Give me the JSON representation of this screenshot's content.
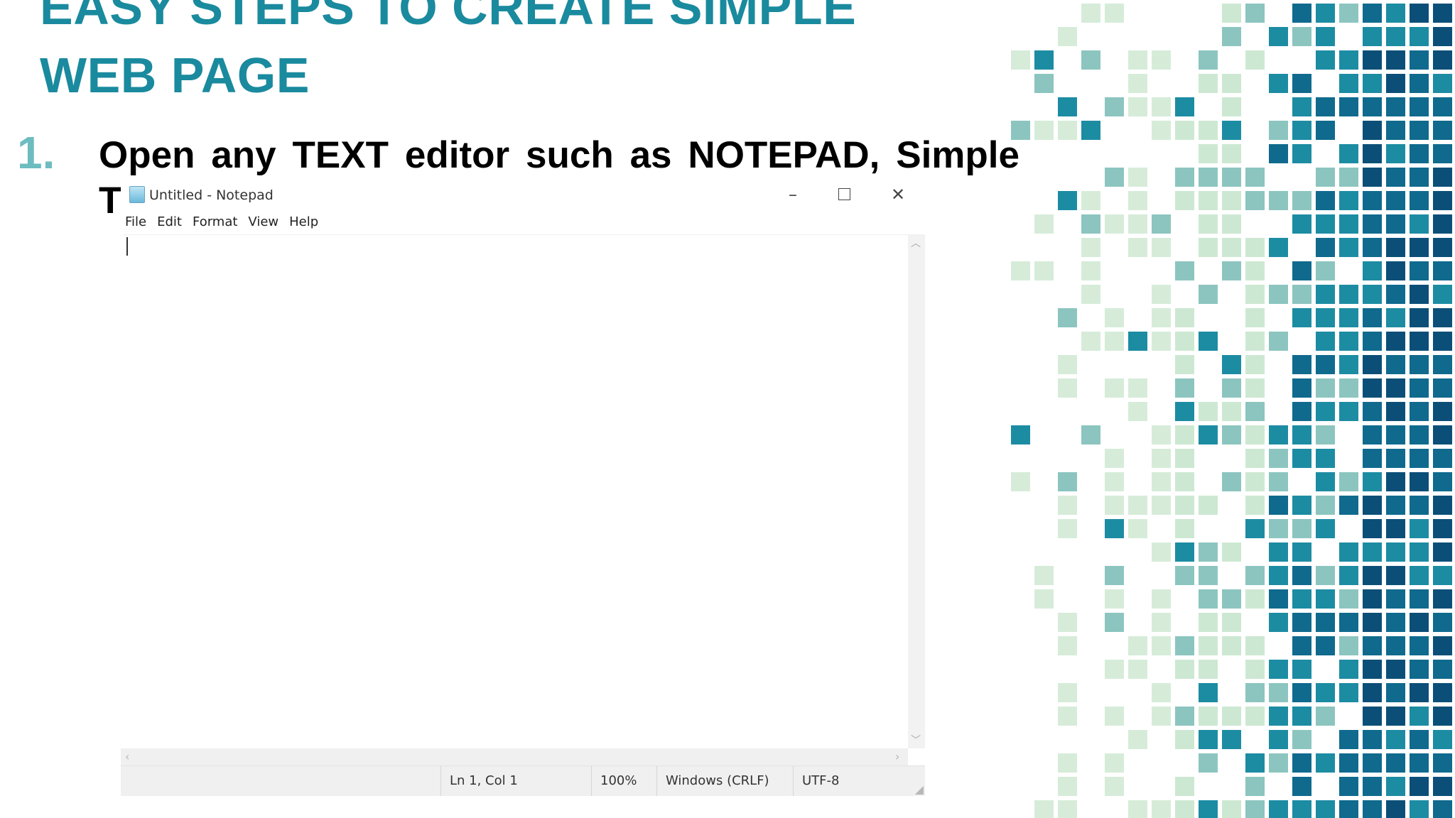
{
  "slide": {
    "title": "EASY STEPS TO CREATE SIMPLE WEB PAGE",
    "step_number": "1.",
    "step_text": "Open any TEXT editor such as NOTEPAD, Simple",
    "step_text_tail": "T"
  },
  "notepad": {
    "window_title": "Untitled - Notepad",
    "controls": {
      "minimize": "–",
      "maximize": "",
      "close": "✕"
    },
    "menu": [
      "File",
      "Edit",
      "Format",
      "View",
      "Help"
    ],
    "editor_text": "",
    "status": {
      "position": "Ln 1, Col 1",
      "zoom": "100%",
      "line_ending": "Windows (CRLF)",
      "encoding": "UTF-8"
    }
  },
  "colors": {
    "title": "#1a8a9e",
    "step_number": "#6dbcc0",
    "mosaic_palette": [
      "#d6ecd9",
      "#cde8d2",
      "#8cc5bf",
      "#1c8ca3",
      "#0f6a8e",
      "#0b4f78"
    ]
  },
  "icons": {
    "app_icon": "notepad-icon",
    "minimize": "minimize-icon",
    "maximize": "maximize-icon",
    "close": "close-icon",
    "scroll_up": "chevron-up-icon",
    "scroll_down": "chevron-down-icon",
    "scroll_left": "chevron-left-icon",
    "scroll_right": "chevron-right-icon"
  }
}
